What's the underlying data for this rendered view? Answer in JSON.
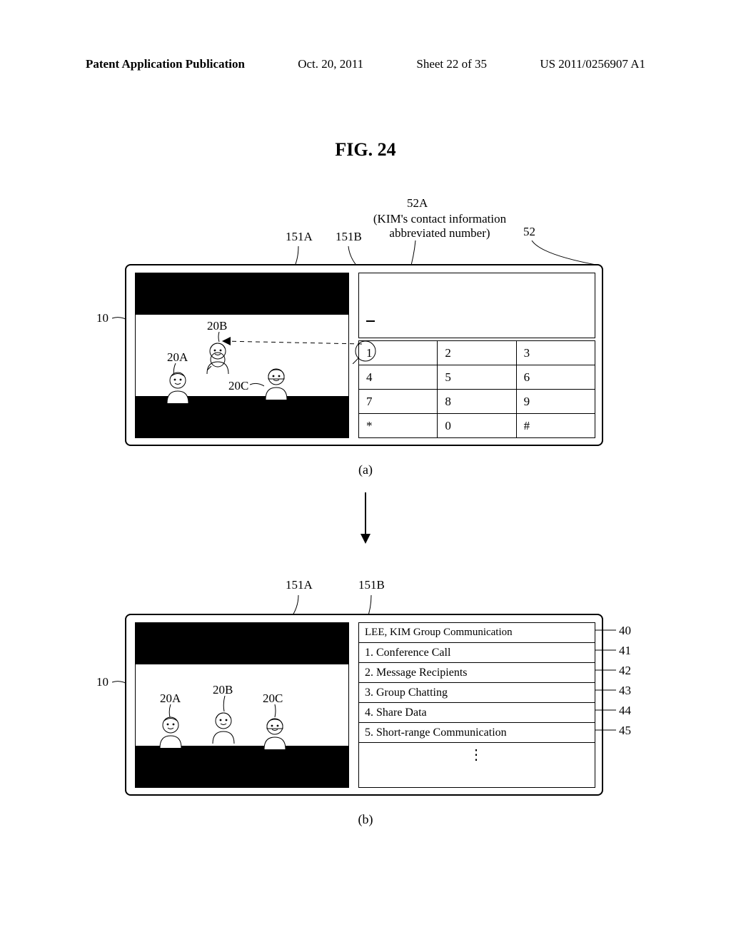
{
  "header": {
    "publication_label": "Patent Application Publication",
    "date": "Oct. 20, 2011",
    "sheet": "Sheet 22 of 35",
    "pubno": "US 2011/0256907 A1"
  },
  "figure_title": "FIG. 24",
  "panel_a": {
    "caption": "(a)",
    "labels": {
      "device": "10",
      "screen_left": "151A",
      "screen_right": "151B",
      "avatar_a": "20A",
      "avatar_b": "20B",
      "avatar_c": "20C",
      "keypad_ref": "52",
      "key1_ref": "52A",
      "key1_desc": "(KIM's contact information abbreviated number)"
    },
    "keypad": [
      "1",
      "2",
      "3",
      "4",
      "5",
      "6",
      "7",
      "8",
      "9",
      "*",
      "0",
      "#"
    ]
  },
  "panel_b": {
    "caption": "(b)",
    "labels": {
      "device": "10",
      "screen_left": "151A",
      "screen_right": "151B",
      "avatar_a": "20A",
      "avatar_b": "20B",
      "avatar_c": "20C",
      "menu_header": "40",
      "menu_item1": "41",
      "menu_item2": "42",
      "menu_item3": "43",
      "menu_item4": "44",
      "menu_item5": "45"
    },
    "menu": {
      "header": "LEE, KIM Group Communication",
      "items": [
        "1. Conference Call",
        "2. Message Recipients",
        "3. Group Chatting",
        "4. Share Data",
        "5. Short-range Communication"
      ],
      "ellipsis": "⋮"
    }
  }
}
